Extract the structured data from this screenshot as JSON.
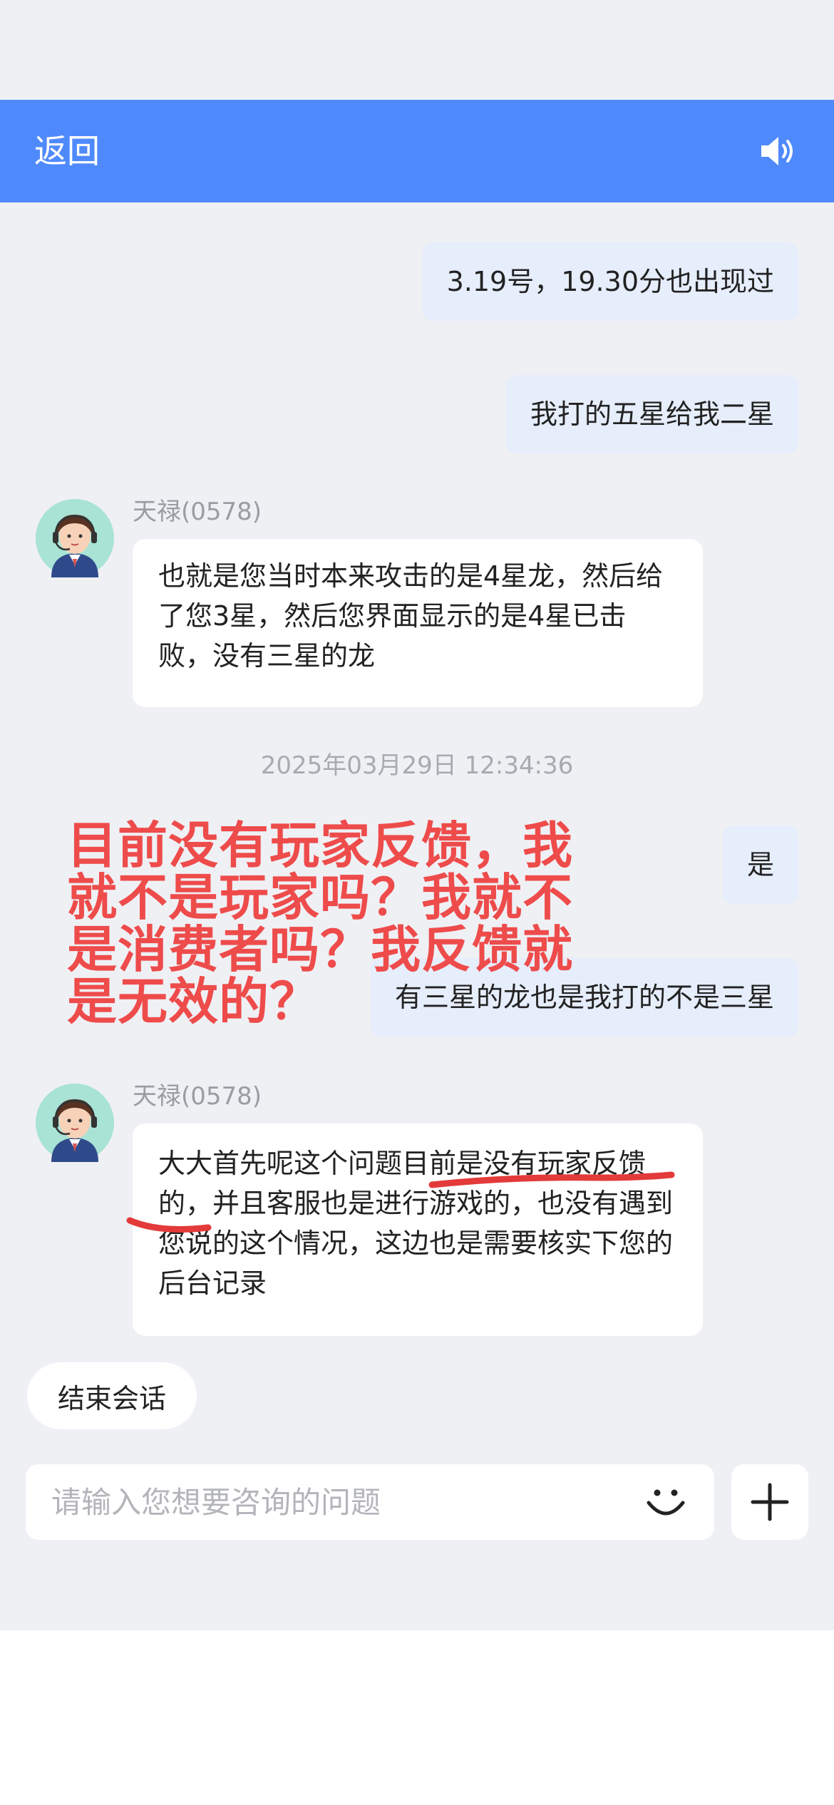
{
  "header": {
    "back_label": "返回",
    "speaker_icon": "speaker-icon"
  },
  "messages": {
    "user_1": "3.19号，19.30分也出现过",
    "user_2": "我打的五星给我二星",
    "agent_1_name": "天禄(0578)",
    "agent_1_text": "也就是您当时本来攻击的是4星龙，然后给了您3星，然后您界面显示的是4星已击败，没有三星的龙",
    "timestamp": "2025年03月29日 12:34:36",
    "user_3": "是",
    "user_4": "有三星的龙也是我打的不是三星",
    "agent_2_name": "天禄(0578)",
    "agent_2_text": "大大首先呢这个问题目前是没有玩家反馈的，并且客服也是进行游戏的，也没有遇到您说的这个情况，这边也是需要核实下您的后台记录"
  },
  "overlay": {
    "text": "目前没有玩家反馈，我就不是玩家吗？我就不是消费者吗？我反馈就是无效的？"
  },
  "footer": {
    "end_session_label": "结束会话",
    "input_placeholder": "请输入您想要咨询的问题",
    "emoji_icon": "smile-icon",
    "plus_icon": "plus-icon"
  },
  "colors": {
    "header": "#4f8afc",
    "user_bubble": "#e6edfb",
    "overlay_red": "#ee4b4b",
    "background": "#eff0f4"
  }
}
